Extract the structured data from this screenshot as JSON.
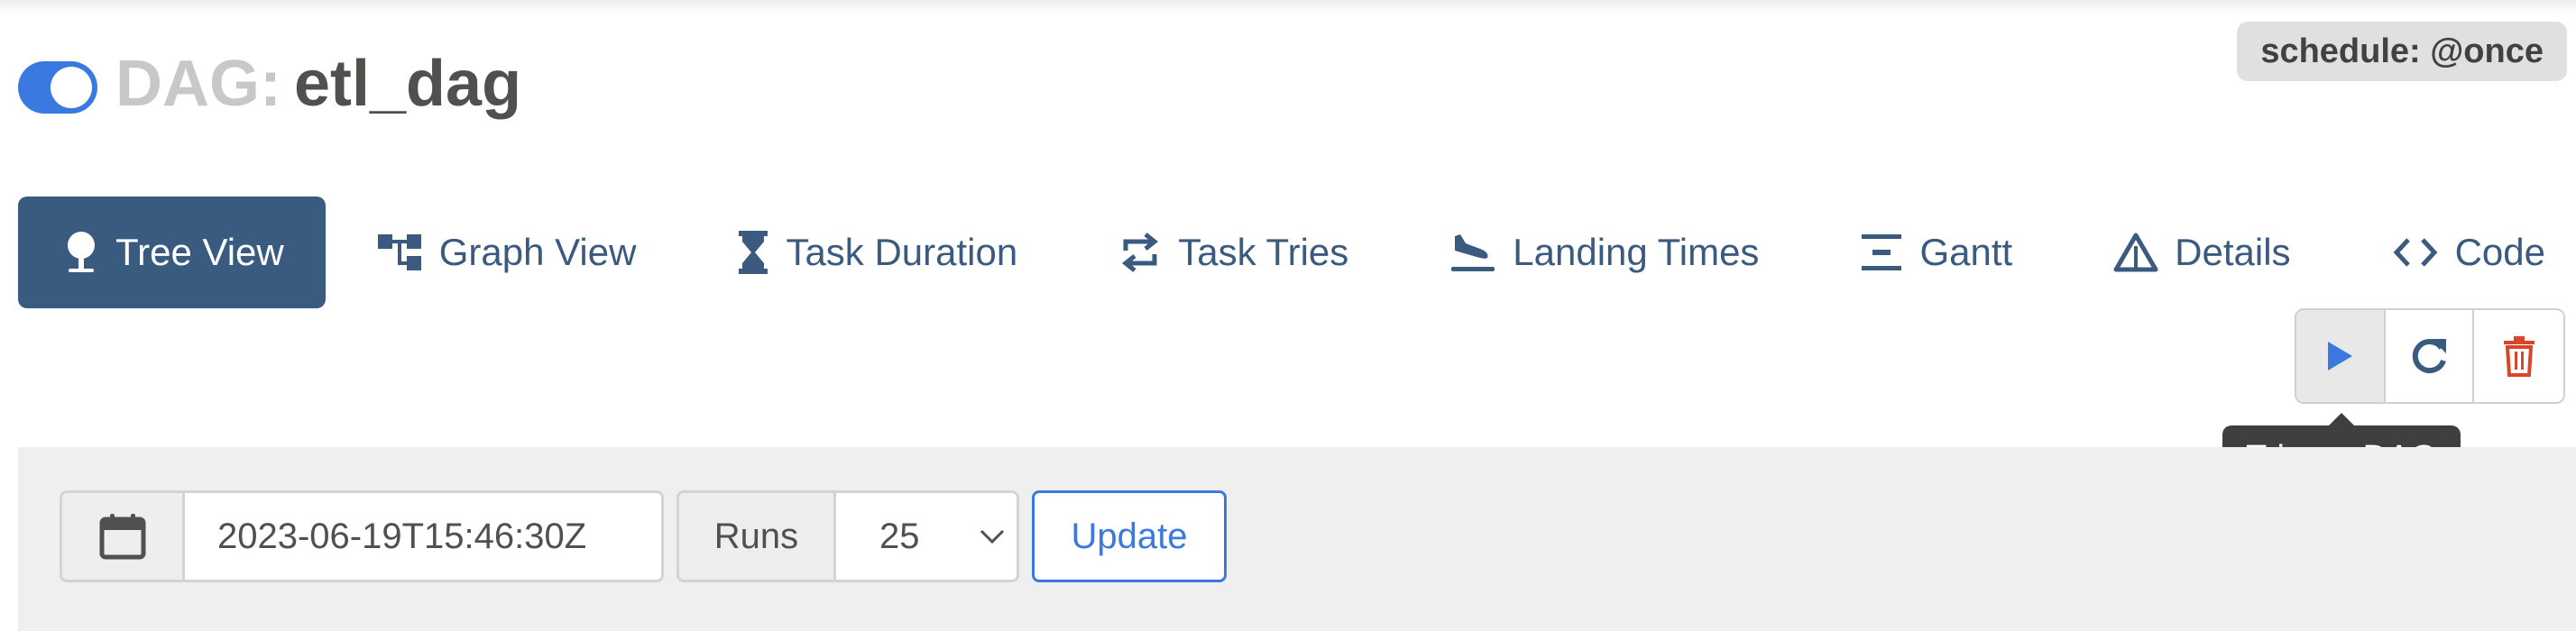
{
  "header": {
    "dag_prefix": "DAG:",
    "dag_id": "etl_dag",
    "schedule_badge": "schedule: @once",
    "toggle_state": "on"
  },
  "nav": {
    "items": [
      {
        "label": "Tree View",
        "icon": "tree-icon",
        "active": true
      },
      {
        "label": "Graph View",
        "icon": "graph-icon",
        "active": false
      },
      {
        "label": "Task Duration",
        "icon": "hourglass-icon",
        "active": false
      },
      {
        "label": "Task Tries",
        "icon": "retweet-icon",
        "active": false
      },
      {
        "label": "Landing Times",
        "icon": "plane-arrival-icon",
        "active": false
      },
      {
        "label": "Gantt",
        "icon": "gantt-icon",
        "active": false
      },
      {
        "label": "Details",
        "icon": "warning-triangle-icon",
        "active": false
      },
      {
        "label": "Code",
        "icon": "code-icon",
        "active": false
      }
    ]
  },
  "actions": {
    "buttons": [
      {
        "icon": "play-icon",
        "color": "#3a7ae0"
      },
      {
        "icon": "refresh-icon",
        "color": "#395b7f"
      },
      {
        "icon": "trash-icon",
        "color": "#d9462b"
      }
    ],
    "tooltip": "Trigger DAG"
  },
  "filters": {
    "calendar_icon": "calendar-icon",
    "base_date": "2023-06-19T15:46:30Z",
    "runs_label": "Runs",
    "runs_value": "25",
    "update_label": "Update"
  },
  "colors": {
    "accent_blue": "#3a7ae0",
    "nav_active_bg": "#395b7f",
    "nav_text": "#3b5a7f",
    "danger": "#d9462b"
  }
}
